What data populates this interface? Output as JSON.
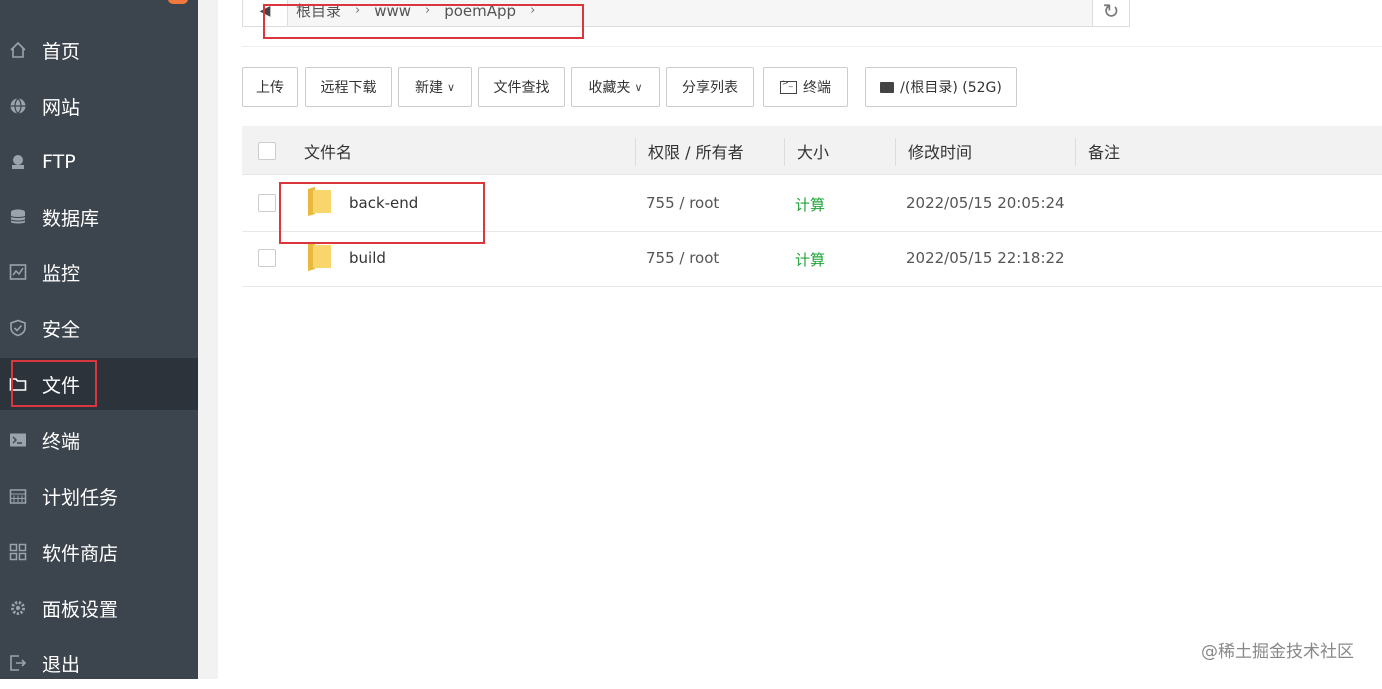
{
  "sidebar": {
    "items": [
      {
        "label": "首页",
        "icon": "home-icon"
      },
      {
        "label": "网站",
        "icon": "globe-icon"
      },
      {
        "label": "FTP",
        "icon": "ftp-icon"
      },
      {
        "label": "数据库",
        "icon": "database-icon"
      },
      {
        "label": "监控",
        "icon": "monitor-icon"
      },
      {
        "label": "安全",
        "icon": "shield-icon"
      },
      {
        "label": "文件",
        "icon": "folder-icon",
        "active": true
      },
      {
        "label": "终端",
        "icon": "terminal-icon"
      },
      {
        "label": "计划任务",
        "icon": "calendar-icon"
      },
      {
        "label": "软件商店",
        "icon": "apps-icon"
      },
      {
        "label": "面板设置",
        "icon": "gear-icon"
      },
      {
        "label": "退出",
        "icon": "logout-icon"
      }
    ]
  },
  "breadcrumb": {
    "items": [
      "根目录",
      "www",
      "poemApp"
    ]
  },
  "toolbar": {
    "upload": "上传",
    "remote_download": "远程下载",
    "new": "新建",
    "file_search": "文件查找",
    "favorites": "收藏夹",
    "share_list": "分享列表",
    "terminal": "终端",
    "disk": "/(根目录) (52G)"
  },
  "table": {
    "headers": {
      "name": "文件名",
      "permission": "权限 / 所有者",
      "size": "大小",
      "modified": "修改时间",
      "note": "备注"
    },
    "rows": [
      {
        "name": "back-end",
        "permission": "755 / root",
        "size": "计算",
        "modified": "2022/05/15 20:05:24",
        "note": ""
      },
      {
        "name": "build",
        "permission": "755 / root",
        "size": "计算",
        "modified": "2022/05/15 22:18:22",
        "note": ""
      }
    ]
  },
  "watermark": "@稀土掘金技术社区",
  "colors": {
    "sidebar_bg": "#3c444d",
    "sidebar_active": "#2c333a",
    "accent_green": "#20a53a",
    "highlight_red": "#d9363e",
    "folder_yellow": "#f9d66b"
  }
}
